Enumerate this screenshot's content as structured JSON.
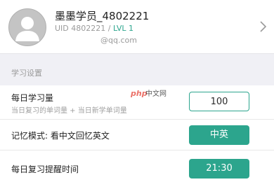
{
  "profile": {
    "username": "墨墨学员_4802221",
    "uid": "UID 4802221",
    "separator": " / ",
    "level": "LVL 1",
    "email": "@qq.com"
  },
  "section": {
    "title": "学习设置"
  },
  "settings": [
    {
      "label": "每日学习量",
      "sublabel": "当日复习的单词量 + 当日新学单词量",
      "value": "100"
    },
    {
      "label": "记忆模式: 看中文回忆英文",
      "value": "中英"
    },
    {
      "label": "每日复习提醒时间",
      "value": "21:30"
    }
  ],
  "watermark": {
    "text": "php中文网"
  },
  "colors": {
    "accent": "#2ca58d",
    "section_bg": "#f0f0f5"
  }
}
